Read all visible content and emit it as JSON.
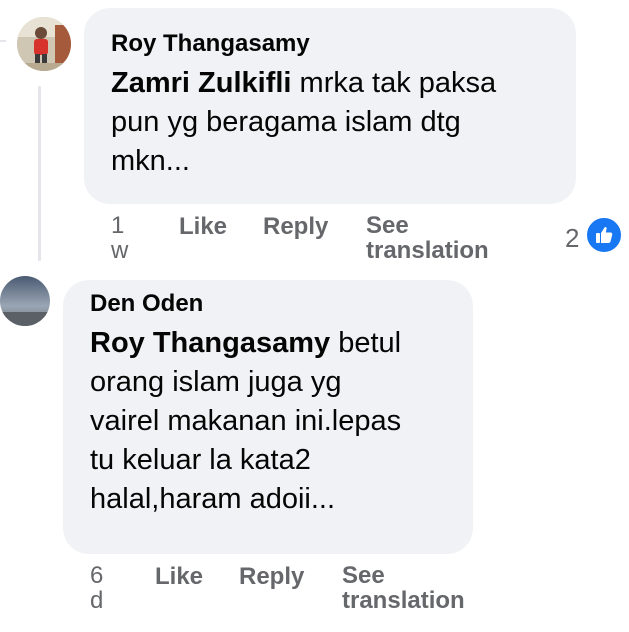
{
  "comments": [
    {
      "author": "Roy Thangasamy",
      "mention": "Zamri Zulkifli",
      "lines": [
        "mrka tak paksa",
        "pun yg beragama islam dtg",
        "mkn..."
      ],
      "time": [
        "1",
        "w"
      ],
      "like_label": "Like",
      "reply_label": "Reply",
      "see_translation": [
        "See",
        "translation"
      ],
      "reaction_count": "2"
    },
    {
      "author": "Den Oden",
      "mention": "Roy Thangasamy",
      "lines": [
        "betul",
        "orang islam juga yg",
        "vairel makanan ini.lepas",
        "tu keluar la kata2",
        "halal,haram adoii..."
      ],
      "time": [
        "6",
        "d"
      ],
      "like_label": "Like",
      "reply_label": "Reply",
      "see_translation": [
        "See",
        "translation"
      ]
    }
  ],
  "colors": {
    "bubble": "#f0f2f5",
    "secondary_text": "#65676b",
    "like_blue": "#1877f2"
  }
}
